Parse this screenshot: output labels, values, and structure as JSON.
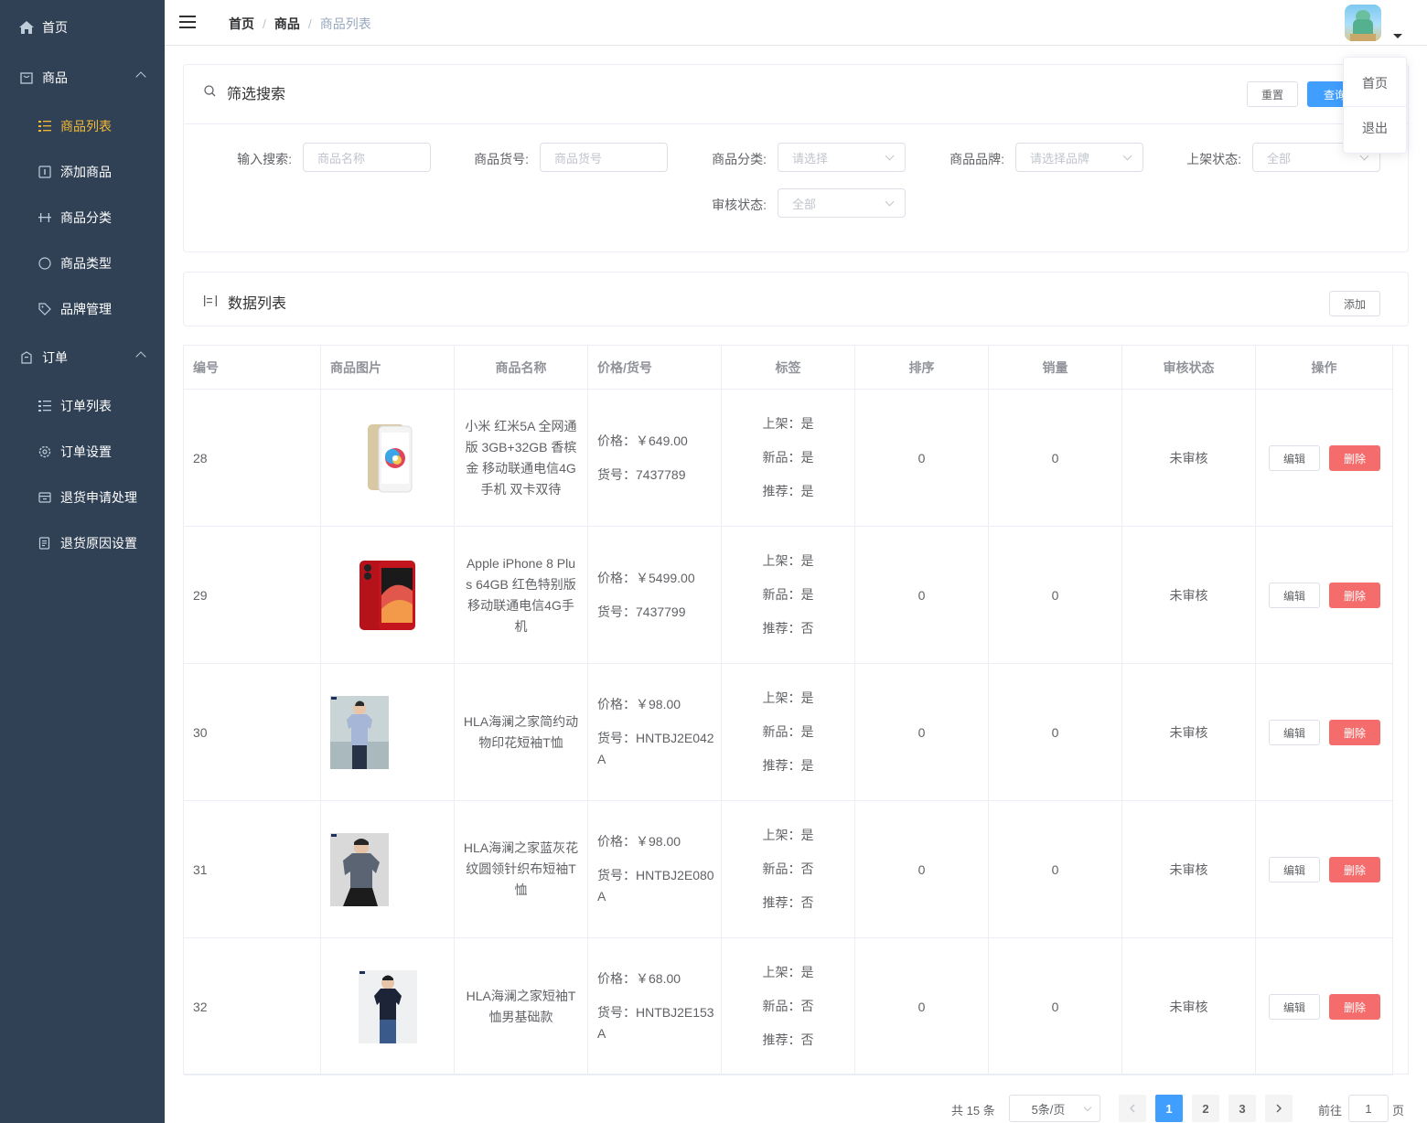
{
  "sidebar": {
    "home": "首页",
    "goods_group": "商品",
    "goods_items": [
      "商品列表",
      "添加商品",
      "商品分类",
      "商品类型",
      "品牌管理"
    ],
    "order_group": "订单",
    "order_items": [
      "订单列表",
      "订单设置",
      "退货申请处理",
      "退货原因设置"
    ],
    "active_color": "#f4b934",
    "background_color": "#304156"
  },
  "navbar": {
    "breadcrumb": [
      "首页",
      "商品",
      "商品列表"
    ],
    "dropdown_items": [
      "首页",
      "退出"
    ]
  },
  "filter": {
    "title": "筛选搜索",
    "reset_label": "重置",
    "query_label": "查询",
    "fields": [
      {
        "label": "输入搜索:",
        "placeholder": "商品名称"
      },
      {
        "label": "商品货号:",
        "placeholder": "商品货号"
      },
      {
        "label": "商品分类:",
        "placeholder": "请选择"
      },
      {
        "label": "商品品牌:",
        "placeholder": "请选择品牌"
      },
      {
        "label": "上架状态:",
        "placeholder": "全部"
      },
      {
        "label": "审核状态:",
        "placeholder": "全部"
      }
    ]
  },
  "list": {
    "title": "数据列表",
    "add_label": "添加"
  },
  "table": {
    "headers": [
      "编号",
      "商品图片",
      "商品名称",
      "价格/货号",
      "标签",
      "排序",
      "销量",
      "审核状态",
      "操作"
    ],
    "edit_label": "编辑",
    "delete_label": "删除",
    "rows": [
      {
        "id": "28",
        "image": "xiaomi-phone-gold",
        "name": "小米 红米5A 全网通版 3GB+32GB 香槟金 移动联通电信4G手机 双卡双待",
        "price": "价格：￥649.00",
        "sn": "货号：7437789",
        "tag_publish": "上架：是",
        "tag_new": "新品：是",
        "tag_recommend": "推荐：是",
        "sort": "0",
        "sales": "0",
        "status": "未审核"
      },
      {
        "id": "29",
        "image": "iphone-red",
        "name": "Apple iPhone 8 Plus 64GB 红色特别版 移动联通电信4G手机",
        "price": "价格：￥5499.00",
        "sn": "货号：7437799",
        "tag_publish": "上架：是",
        "tag_new": "新品：是",
        "tag_recommend": "推荐：否",
        "sort": "0",
        "sales": "0",
        "status": "未审核"
      },
      {
        "id": "30",
        "image": "tshirt-light-blue",
        "name": "HLA海澜之家简约动物印花短袖T恤",
        "price": "价格：￥98.00",
        "sn": "货号：HNTBJ2E042A",
        "tag_publish": "上架：是",
        "tag_new": "新品：是",
        "tag_recommend": "推荐：是",
        "sort": "0",
        "sales": "0",
        "status": "未审核"
      },
      {
        "id": "31",
        "image": "tshirt-grey-pattern",
        "name": "HLA海澜之家蓝灰花纹圆领针织布短袖T恤",
        "price": "价格：￥98.00",
        "sn": "货号：HNTBJ2E080A",
        "tag_publish": "上架：是",
        "tag_new": "新品：否",
        "tag_recommend": "推荐：否",
        "sort": "0",
        "sales": "0",
        "status": "未审核"
      },
      {
        "id": "32",
        "image": "tshirt-navy",
        "name": "HLA海澜之家短袖T恤男基础款",
        "price": "价格：￥68.00",
        "sn": "货号：HNTBJ2E153A",
        "tag_publish": "上架：是",
        "tag_new": "新品：否",
        "tag_recommend": "推荐：否",
        "sort": "0",
        "sales": "0",
        "status": "未审核"
      }
    ]
  },
  "pagination": {
    "total": "共 15 条",
    "page_size": "5条/页",
    "pages": [
      "1",
      "2",
      "3"
    ],
    "current": "1",
    "goto_label": "前往",
    "goto_value": "1",
    "page_suffix": "页"
  },
  "colors": {
    "primary": "#409eff",
    "danger": "#f56c6c"
  }
}
